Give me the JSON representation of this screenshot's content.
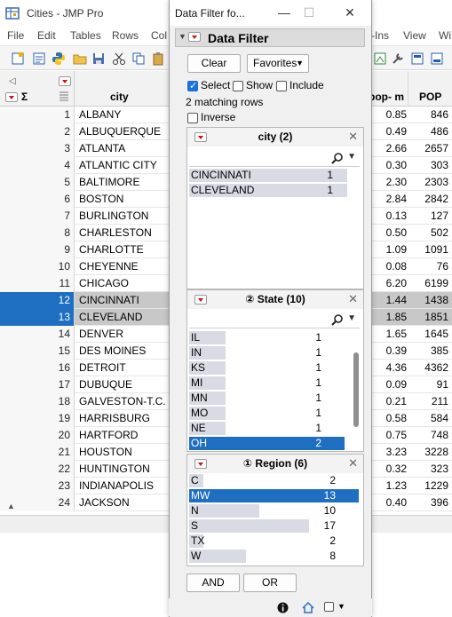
{
  "app": {
    "title": "Cities - JMP Pro"
  },
  "menubar": [
    "File",
    "Edit",
    "Tables",
    "Rows",
    "Col",
    "-Ins",
    "View",
    "Wi"
  ],
  "grid": {
    "col_city": "city",
    "col_popm": "pop- m",
    "col_pop": "POP",
    "rows": [
      {
        "n": "1",
        "city": "ALBANY",
        "popm": "0.85",
        "pop": "846"
      },
      {
        "n": "2",
        "city": "ALBUQUERQUE",
        "popm": "0.49",
        "pop": "486"
      },
      {
        "n": "3",
        "city": "ATLANTA",
        "popm": "2.66",
        "pop": "2657"
      },
      {
        "n": "4",
        "city": "ATLANTIC CITY",
        "popm": "0.30",
        "pop": "303"
      },
      {
        "n": "5",
        "city": "BALTIMORE",
        "popm": "2.30",
        "pop": "2303"
      },
      {
        "n": "6",
        "city": "BOSTON",
        "popm": "2.84",
        "pop": "2842"
      },
      {
        "n": "7",
        "city": "BURLINGTON",
        "popm": "0.13",
        "pop": "127"
      },
      {
        "n": "8",
        "city": "CHARLESTON",
        "popm": "0.50",
        "pop": "502"
      },
      {
        "n": "9",
        "city": "CHARLOTTE",
        "popm": "1.09",
        "pop": "1091"
      },
      {
        "n": "10",
        "city": "CHEYENNE",
        "popm": "0.08",
        "pop": "76"
      },
      {
        "n": "11",
        "city": "CHICAGO",
        "popm": "6.20",
        "pop": "6199"
      },
      {
        "n": "12",
        "city": "CINCINNATI",
        "popm": "1.44",
        "pop": "1438"
      },
      {
        "n": "13",
        "city": "CLEVELAND",
        "popm": "1.85",
        "pop": "1851"
      },
      {
        "n": "14",
        "city": "DENVER",
        "popm": "1.65",
        "pop": "1645"
      },
      {
        "n": "15",
        "city": "DES MOINES",
        "popm": "0.39",
        "pop": "385"
      },
      {
        "n": "16",
        "city": "DETROIT",
        "popm": "4.36",
        "pop": "4362"
      },
      {
        "n": "17",
        "city": "DUBUQUE",
        "popm": "0.09",
        "pop": "91"
      },
      {
        "n": "18",
        "city": "GALVESTON-T.C.",
        "popm": "0.21",
        "pop": "211"
      },
      {
        "n": "19",
        "city": "HARRISBURG",
        "popm": "0.58",
        "pop": "584"
      },
      {
        "n": "20",
        "city": "HARTFORD",
        "popm": "0.75",
        "pop": "748"
      },
      {
        "n": "21",
        "city": "HOUSTON",
        "popm": "3.23",
        "pop": "3228"
      },
      {
        "n": "22",
        "city": "HUNTINGTON",
        "popm": "0.32",
        "pop": "323"
      },
      {
        "n": "23",
        "city": "INDIANAPOLIS",
        "popm": "1.23",
        "pop": "1229"
      },
      {
        "n": "24",
        "city": "JACKSON",
        "popm": "0.40",
        "pop": "396"
      }
    ]
  },
  "filter": {
    "window_title": "Data Filter fo...",
    "header_title": "Data Filter",
    "clear_label": "Clear",
    "favorites_label": "Favorites",
    "select_label": "Select",
    "show_label": "Show",
    "include_label": "Include",
    "matching_text": "2 matching rows",
    "inverse_label": "Inverse",
    "city_panel": {
      "title": "city (2)",
      "items": [
        {
          "label": "CINCINNATI",
          "count": "1"
        },
        {
          "label": "CLEVELAND",
          "count": "1"
        }
      ]
    },
    "state_panel": {
      "title": "② State (10)",
      "items": [
        {
          "label": "IL",
          "count": "1"
        },
        {
          "label": "IN",
          "count": "1"
        },
        {
          "label": "KS",
          "count": "1"
        },
        {
          "label": "MI",
          "count": "1"
        },
        {
          "label": "MN",
          "count": "1"
        },
        {
          "label": "MO",
          "count": "1"
        },
        {
          "label": "NE",
          "count": "1"
        },
        {
          "label": "OH",
          "count": "2"
        }
      ]
    },
    "region_panel": {
      "title": "① Region (6)",
      "items": [
        {
          "label": "C",
          "count": "2"
        },
        {
          "label": "MW",
          "count": "13"
        },
        {
          "label": "N",
          "count": "10"
        },
        {
          "label": "S",
          "count": "17"
        },
        {
          "label": "TX",
          "count": "2"
        },
        {
          "label": "W",
          "count": "8"
        }
      ]
    },
    "and_label": "AND",
    "or_label": "OR"
  }
}
